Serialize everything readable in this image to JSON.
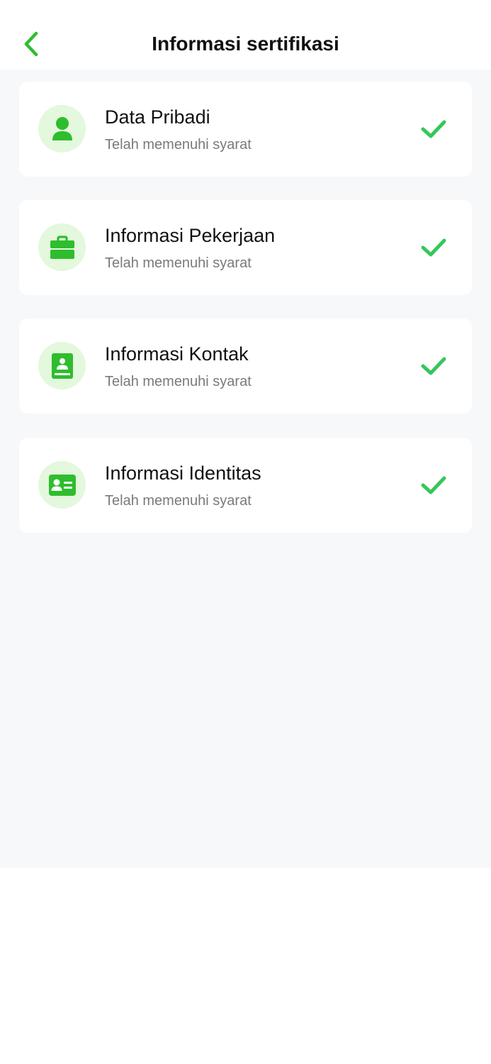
{
  "header": {
    "title": "Informasi sertifikasi",
    "back_icon": "chevron-left-icon"
  },
  "colors": {
    "accent": "#2ebd2e",
    "check": "#34c759",
    "icon_bg": "#e3f8dc",
    "page_bg": "#f7f8fa"
  },
  "items": [
    {
      "title": "Data Pribadi",
      "status": "Telah memenuhi syarat",
      "icon": "person-icon",
      "complete": true
    },
    {
      "title": "Informasi Pekerjaan",
      "status": "Telah memenuhi syarat",
      "icon": "briefcase-icon",
      "complete": true
    },
    {
      "title": "Informasi Kontak",
      "status": "Telah memenuhi syarat",
      "icon": "contact-book-icon",
      "complete": true
    },
    {
      "title": "Informasi Identitas",
      "status": "Telah memenuhi syarat",
      "icon": "id-card-icon",
      "complete": true
    }
  ]
}
